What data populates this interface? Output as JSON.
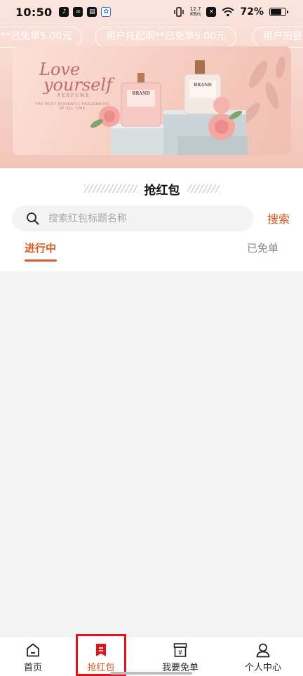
{
  "status_bar": {
    "time": "10:50",
    "network_speed_top": "12.7",
    "network_speed_unit": "KB/s",
    "battery": "72%"
  },
  "marquee": {
    "items": [
      "**已免单5.00元",
      "用户托起明**已免单5.00元",
      "用户田登"
    ]
  },
  "banner": {
    "headline_1": "Love",
    "headline_2": "yourself",
    "subline": "PERFUME",
    "tagline_1": "THE MOST ROMANTIC FRAGRANCES",
    "tagline_2": "OF ALL TIME",
    "bottle_label": "BRAND",
    "colors": {
      "accent": "#c06a73"
    }
  },
  "section": {
    "title": "抢红包"
  },
  "search": {
    "placeholder": "搜索红包标题名称",
    "value": "",
    "button_label": "搜索"
  },
  "tabs": [
    {
      "label": "进行中",
      "active": true
    },
    {
      "label": "已免单",
      "active": false
    }
  ],
  "bottom_nav": {
    "items": [
      {
        "label": "首页",
        "icon": "home-icon",
        "active": false
      },
      {
        "label": "抢红包",
        "icon": "red-envelope-icon",
        "active": true
      },
      {
        "label": "我要免单",
        "icon": "yen-box-icon",
        "active": false
      },
      {
        "label": "个人中心",
        "icon": "user-icon",
        "active": false
      }
    ]
  },
  "colors": {
    "brand": "#d9591f",
    "highlight": "#e0141b"
  }
}
